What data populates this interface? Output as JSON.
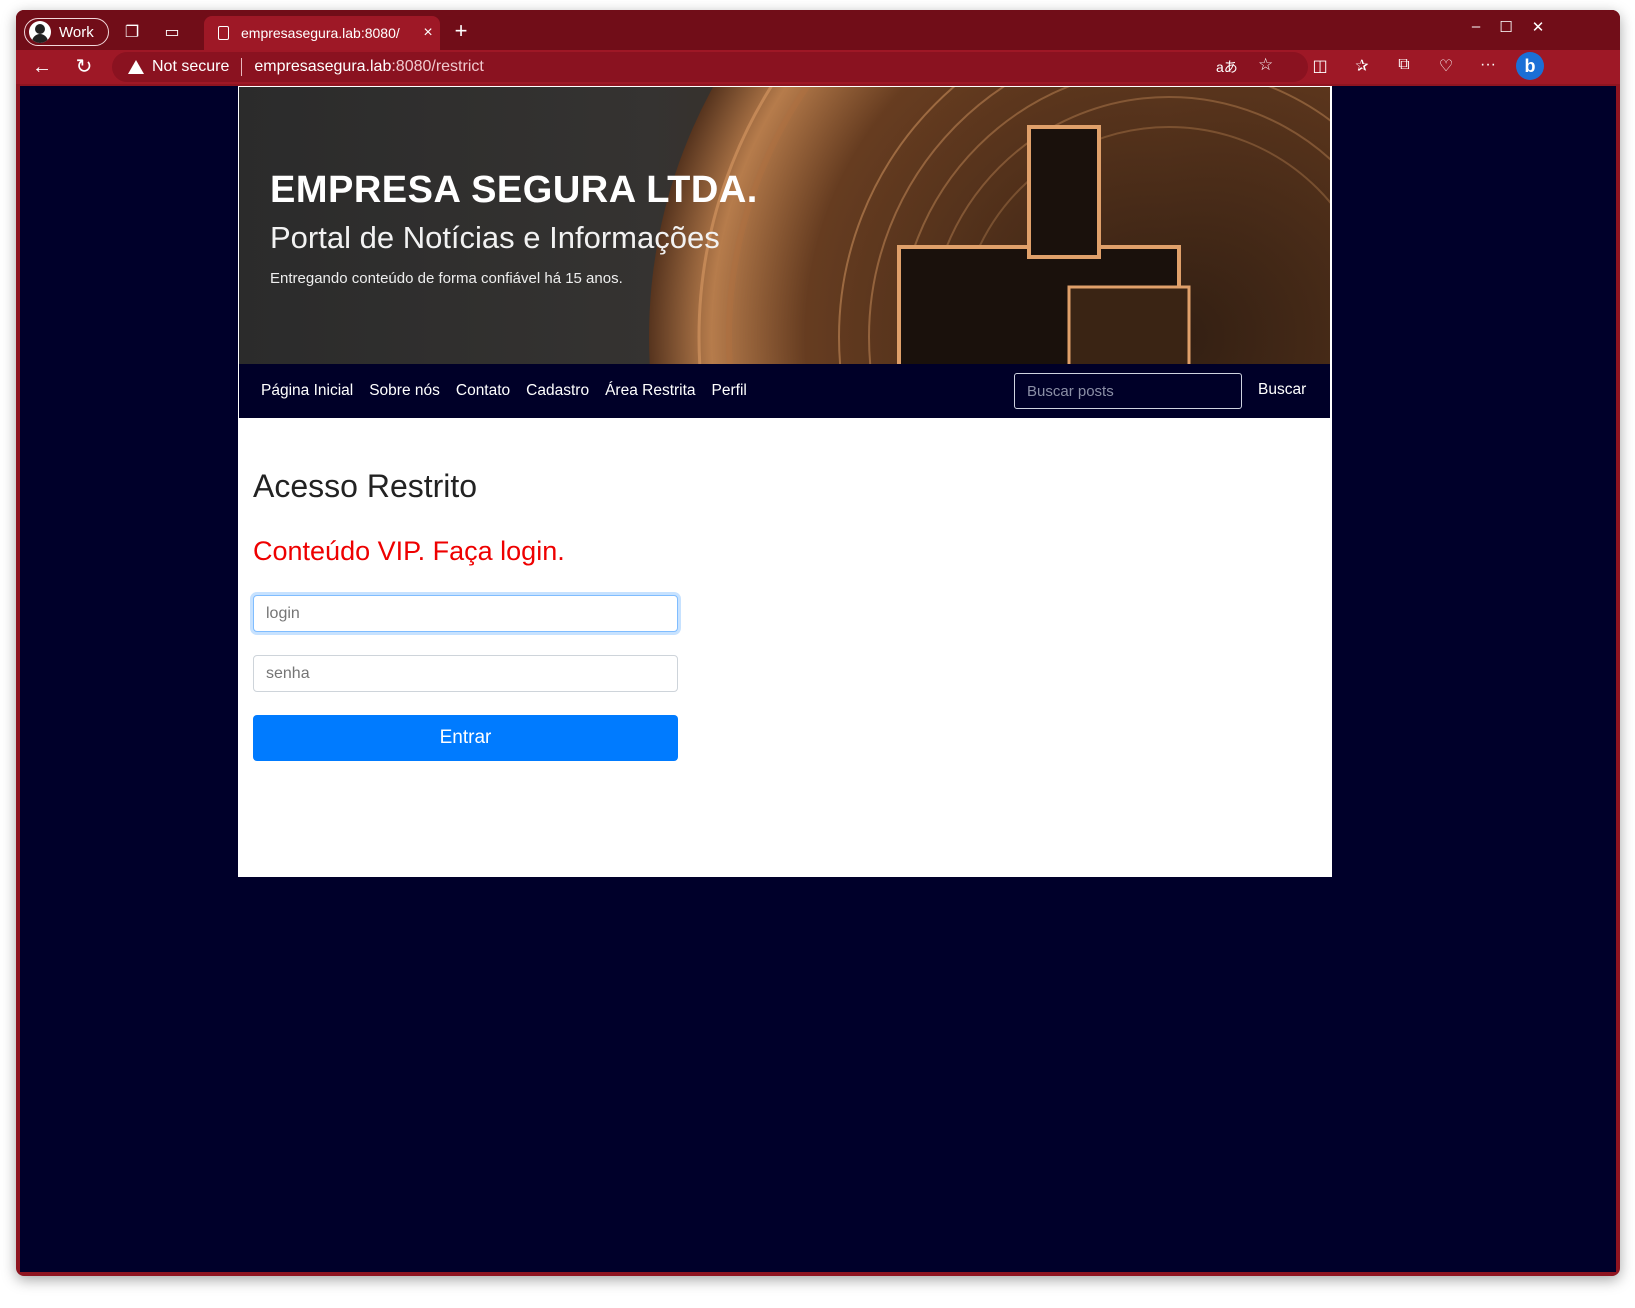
{
  "browser": {
    "profile_label": "Work",
    "tab_title": "empresasegura.lab:8080/",
    "tab_close": "×",
    "new_tab": "+",
    "security_label": "Not secure",
    "url_host": "empresasegura.lab",
    "url_path": ":8080/restrict",
    "read_aloud": "aあ",
    "more": "···",
    "bing": "b"
  },
  "header": {
    "title": "EMPRESA SEGURA LTDA.",
    "subtitle": "Portal de Notícias e Informações",
    "tagline": "Entregando conteúdo de forma confiável há 15 anos."
  },
  "nav": {
    "items": [
      "Página Inicial",
      "Sobre nós",
      "Contato",
      "Cadastro",
      "Área Restrita",
      "Perfil"
    ],
    "search_placeholder": "Buscar posts",
    "search_button": "Buscar"
  },
  "main": {
    "heading": "Acesso Restrito",
    "message": "Conteúdo VIP. Faça login.",
    "login_placeholder": "login",
    "password_placeholder": "senha",
    "submit_label": "Entrar"
  },
  "colors": {
    "browser_frame": "#8e1420",
    "page_background": "#00002a",
    "primary_button": "#007bff",
    "alert_text": "#ee0000"
  }
}
